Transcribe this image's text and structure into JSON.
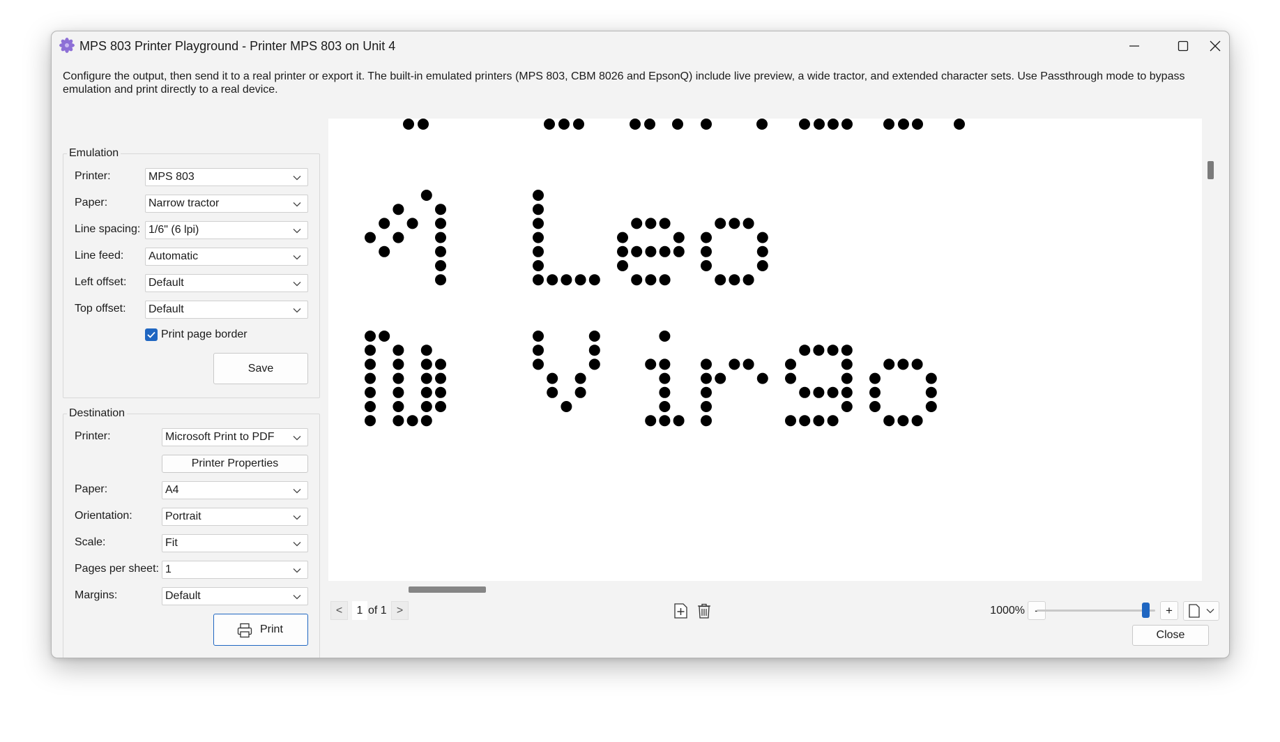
{
  "window": {
    "title": "MPS 803 Printer Playground - Printer MPS 803 on Unit 4",
    "accent_color": "#1f66c1",
    "controls": [
      "minimize-icon",
      "maximize-icon",
      "close-icon"
    ]
  },
  "description": "Configure the output, then send it to a real printer or export it. The built-in emulated printers (MPS 803, CBM 8026 and EpsonQ) include live preview, a wide tractor, and extended character sets. Use Passthrough mode to bypass emulation and print directly to a real device.",
  "emulation": {
    "legend": "Emulation",
    "printer_label": "Printer:",
    "printer_value": "MPS 803",
    "paper_label": "Paper:",
    "paper_value": "Narrow tractor",
    "line_spacing_label": "Line spacing:",
    "line_spacing_value": "1/6\" (6 lpi)",
    "line_feed_label": "Line feed:",
    "line_feed_value": "Automatic",
    "left_offset_label": "Left offset:",
    "left_offset_value": "Default",
    "top_offset_label": "Top offset:",
    "top_offset_value": "Default",
    "print_border_label": "Print page border",
    "print_border_checked": true,
    "save_label": "Save"
  },
  "destination": {
    "legend": "Destination",
    "printer_label": "Printer:",
    "printer_value": "Microsoft Print to PDF",
    "properties_label": "Printer Properties",
    "paper_label": "Paper:",
    "paper_value": "A4",
    "orientation_label": "Orientation:",
    "orientation_value": "Portrait",
    "scale_label": "Scale:",
    "scale_value": "Fit",
    "pages_per_sheet_label": "Pages per sheet:",
    "pages_per_sheet_value": "1",
    "margins_label": "Margins:",
    "margins_value": "Default",
    "print_label": "Print"
  },
  "preview": {
    "printed_lines": [
      "♌ Leo",
      "♍ Virgo"
    ],
    "dot_color": "#000000"
  },
  "pager": {
    "prev": "<",
    "current": "1",
    "of_text": "of 1",
    "next": ">"
  },
  "toolbar": {
    "add_page_icon": "add-page-icon",
    "delete_icon": "trash-icon",
    "zoom": "1000%",
    "zoom_out": "-",
    "zoom_in": "+",
    "zoom_slider_fraction": 0.95,
    "page_size_icon": "page-icon"
  },
  "close_label": "Close"
}
